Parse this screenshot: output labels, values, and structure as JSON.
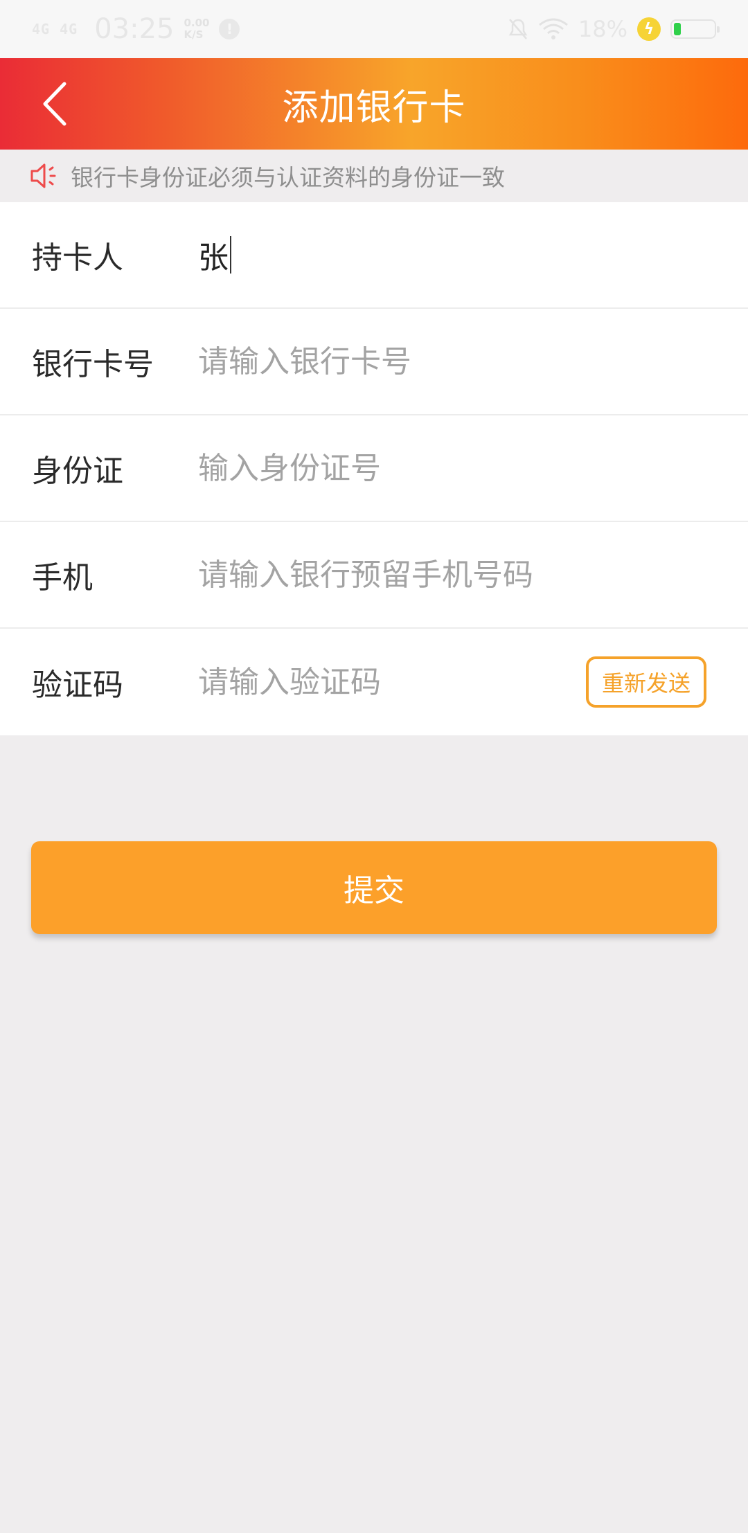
{
  "status_bar": {
    "signal_1": "4G",
    "signal_2": "4G",
    "time": "03:25",
    "net_speed_value": "0.00",
    "net_speed_unit": "K/S",
    "battery_percent": "18%",
    "battery_level": 0.18
  },
  "header": {
    "title": "添加银行卡"
  },
  "notice": {
    "text": "银行卡身份证必须与认证资料的身份证一致"
  },
  "form": {
    "cardholder": {
      "label": "持卡人",
      "value": "张"
    },
    "card_number": {
      "label": "银行卡号",
      "placeholder": "请输入银行卡号"
    },
    "id_card": {
      "label": "身份证",
      "placeholder": "输入身份证号"
    },
    "phone": {
      "label": "手机",
      "placeholder": "请输入银行预留手机号码"
    },
    "verify_code": {
      "label": "验证码",
      "placeholder": "请输入验证码",
      "resend_label": "重新发送"
    }
  },
  "submit": {
    "label": "提交"
  },
  "colors": {
    "accent": "#fca02a",
    "header_gradient_start": "#ea2c36",
    "header_gradient_end": "#fd6a0c"
  }
}
